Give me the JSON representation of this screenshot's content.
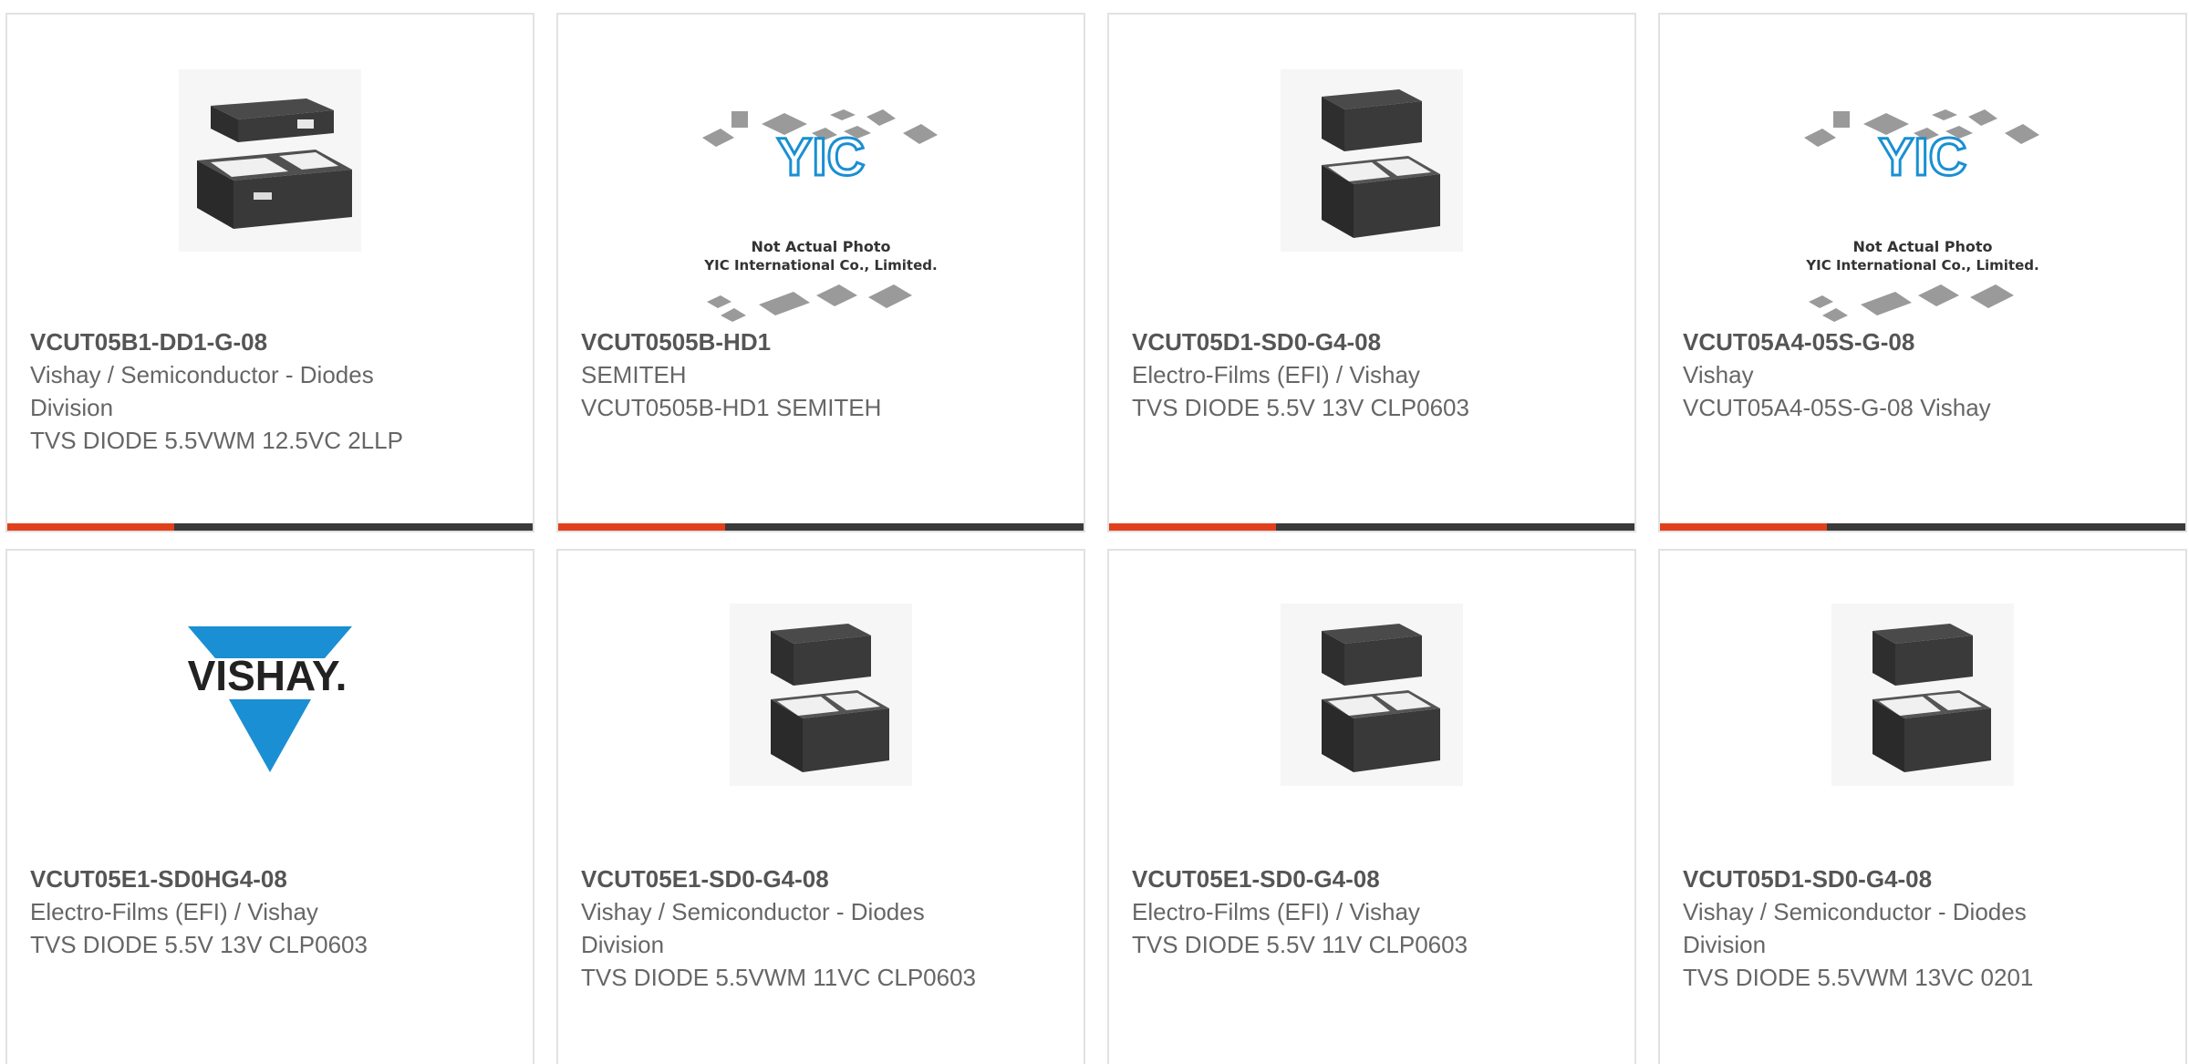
{
  "products": [
    {
      "part_number": "VCUT05B1-DD1-G-08",
      "manufacturer": "Vishay / Semiconductor - Diodes Division",
      "description": "TVS DIODE 5.5VWM 12.5VC 2LLP",
      "image": "package-llp-icon"
    },
    {
      "part_number": "VCUT0505B-HD1",
      "manufacturer": "SEMITEH",
      "description": "VCUT0505B-HD1 SEMITEH",
      "image": "not-actual-photo-icon",
      "image_caption": [
        "Not Actual Photo",
        "YIC International Co., Limited."
      ]
    },
    {
      "part_number": "VCUT05D1-SD0-G4-08",
      "manufacturer": "Electro-Films (EFI) / Vishay",
      "description": "TVS DIODE 5.5V 13V CLP0603",
      "image": "package-clp-icon"
    },
    {
      "part_number": "VCUT05A4-05S-G-08",
      "manufacturer": "Vishay",
      "description": "VCUT05A4-05S-G-08 Vishay",
      "image": "not-actual-photo-icon",
      "image_caption": [
        "Not Actual Photo",
        "YIC International Co., Limited."
      ]
    },
    {
      "part_number": "VCUT05E1-SD0HG4-08",
      "manufacturer": "Electro-Films (EFI) / Vishay",
      "description": "TVS DIODE 5.5V 13V CLP0603",
      "image": "vishay-logo",
      "image_caption": [
        "VISHAY."
      ]
    },
    {
      "part_number": "VCUT05E1-SD0-G4-08",
      "manufacturer": "Vishay / Semiconductor - Diodes Division",
      "description": "TVS DIODE 5.5VWM 11VC CLP0603",
      "image": "package-clp-icon"
    },
    {
      "part_number": "VCUT05E1-SD0-G4-08",
      "manufacturer": "Electro-Films (EFI) / Vishay",
      "description": "TVS DIODE 5.5V 11V CLP0603",
      "image": "package-clp-icon"
    },
    {
      "part_number": "VCUT05D1-SD0-G4-08",
      "manufacturer": "Vishay / Semiconductor - Diodes Division",
      "description": "TVS DIODE 5.5VWM 13VC 0201",
      "image": "package-clp-icon"
    }
  ],
  "colors": {
    "accent": "#e0401c",
    "bar": "#3a3a3a",
    "text": "#666666",
    "vishay_blue": "#1a8fd3"
  }
}
